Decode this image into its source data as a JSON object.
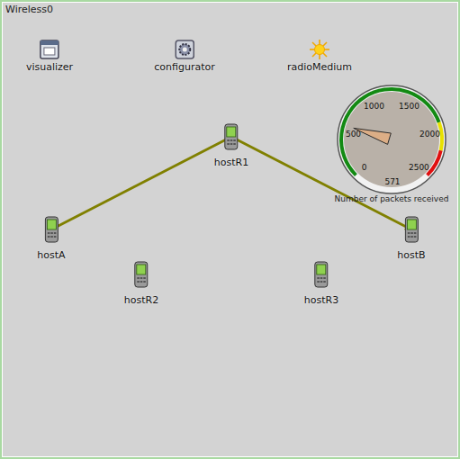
{
  "canvas": {
    "title": "Wireless0"
  },
  "modules": [
    {
      "label": "visualizer",
      "kind": "visualizer"
    },
    {
      "label": "configurator",
      "kind": "configurator"
    },
    {
      "label": "radioMedium",
      "kind": "radio"
    }
  ],
  "hosts": [
    {
      "label": "hostR1"
    },
    {
      "label": "hostA"
    },
    {
      "label": "hostB"
    },
    {
      "label": "hostR2"
    },
    {
      "label": "hostR3"
    }
  ],
  "links": [
    {
      "from": "hostA",
      "to": "hostR1",
      "arrow": false
    },
    {
      "from": "hostR1",
      "to": "hostB",
      "arrow": true
    }
  ],
  "gauge": {
    "title": "Number of packets received",
    "ticks": [
      "0",
      "500",
      "1000",
      "1500",
      "2000",
      "2500"
    ],
    "value": "571",
    "level": 0.2284
  }
}
